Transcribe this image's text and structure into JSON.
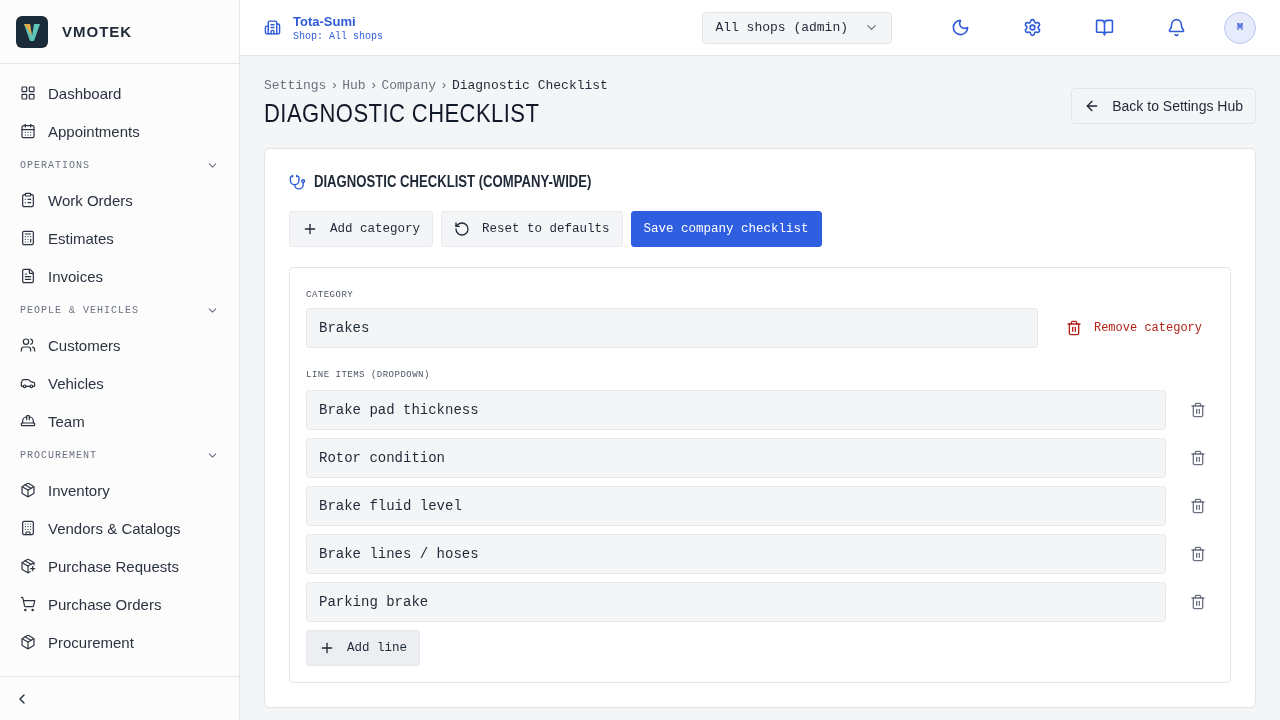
{
  "sidebar": {
    "brand": "VMOTEK",
    "groups": [
      {
        "items": [
          {
            "label": "Dashboard"
          },
          {
            "label": "Appointments"
          }
        ]
      },
      {
        "label": "OPERATIONS",
        "expanded": true,
        "items": [
          {
            "label": "Work Orders"
          },
          {
            "label": "Estimates"
          },
          {
            "label": "Invoices"
          }
        ]
      },
      {
        "label": "PEOPLE & VEHICLES",
        "expanded": true,
        "items": [
          {
            "label": "Customers"
          },
          {
            "label": "Vehicles"
          },
          {
            "label": "Team"
          }
        ]
      },
      {
        "label": "PROCUREMENT",
        "expanded": true,
        "items": [
          {
            "label": "Inventory"
          },
          {
            "label": "Vendors & Catalogs"
          },
          {
            "label": "Purchase Requests"
          },
          {
            "label": "Purchase Orders"
          },
          {
            "label": "Procurement"
          }
        ]
      }
    ]
  },
  "topbar": {
    "company": "Tota-Sumi",
    "shop": "Shop: All shops",
    "shop_select": "All shops (admin)",
    "avatar": "M"
  },
  "breadcrumb": [
    "Settings",
    "Hub",
    "Company",
    "Diagnostic Checklist"
  ],
  "breadcrumb_separator": "›",
  "page_title": "DIAGNOSTIC CHECKLIST",
  "back_button": "Back to Settings Hub",
  "card": {
    "title": "DIAGNOSTIC CHECKLIST (COMPANY-WIDE)",
    "actions": [
      {
        "kind": "add",
        "label": "Add category"
      },
      {
        "kind": "reset",
        "label": "Reset to defaults"
      },
      {
        "kind": "primary",
        "label": "Save company checklist"
      }
    ],
    "category": {
      "label": "CATEGORY",
      "value": "Brakes",
      "remove": "Remove category",
      "items_label": "LINE ITEMS (DROPDOWN)",
      "items": [
        "Brake pad thickness",
        "Rotor condition",
        "Brake fluid level",
        "Brake lines / hoses",
        "Parking brake"
      ],
      "add_line": "Add line"
    }
  }
}
